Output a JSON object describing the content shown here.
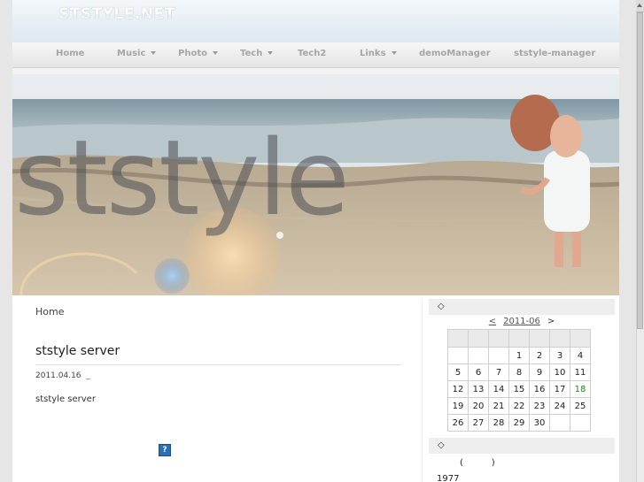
{
  "site": {
    "logo": "STSTYLE.NET"
  },
  "nav": {
    "items": [
      {
        "label": "Home",
        "has_dropdown": false
      },
      {
        "label": "Music",
        "has_dropdown": true
      },
      {
        "label": "Photo",
        "has_dropdown": true
      },
      {
        "label": "Tech",
        "has_dropdown": true
      },
      {
        "label": "Tech2",
        "has_dropdown": false
      },
      {
        "label": "Links",
        "has_dropdown": true
      },
      {
        "label": "demoManager",
        "has_dropdown": false
      },
      {
        "label": "ststyle-manager",
        "has_dropdown": false
      }
    ]
  },
  "header": {
    "image_text": "ststyle"
  },
  "breadcrumb": "Home",
  "post": {
    "title": "ststyle server",
    "date": "2011.04.16",
    "date_suffix": "_",
    "body": "ststyle server",
    "help_icon": "?"
  },
  "sidebar": {
    "widget1_marker": "◇",
    "widget2_marker": "◇",
    "calendar": {
      "prev": "<",
      "month": "2011-06",
      "next": ">",
      "weeks": [
        [
          "",
          "",
          "",
          "1",
          "2",
          "3",
          "4"
        ],
        [
          "5",
          "6",
          "7",
          "8",
          "9",
          "10",
          "11"
        ],
        [
          "12",
          "13",
          "14",
          "15",
          "16",
          "17",
          "18"
        ],
        [
          "19",
          "20",
          "21",
          "22",
          "23",
          "24",
          "25"
        ],
        [
          "26",
          "27",
          "28",
          "29",
          "30",
          "",
          ""
        ]
      ],
      "highlight_day": "18",
      "highlight_color": "#1f8a1f"
    },
    "paren_text": "(          )",
    "year_text": "1977"
  },
  "colors": {
    "nav_text": "#a5a5a5",
    "page_bg": "#e6e6e6"
  }
}
